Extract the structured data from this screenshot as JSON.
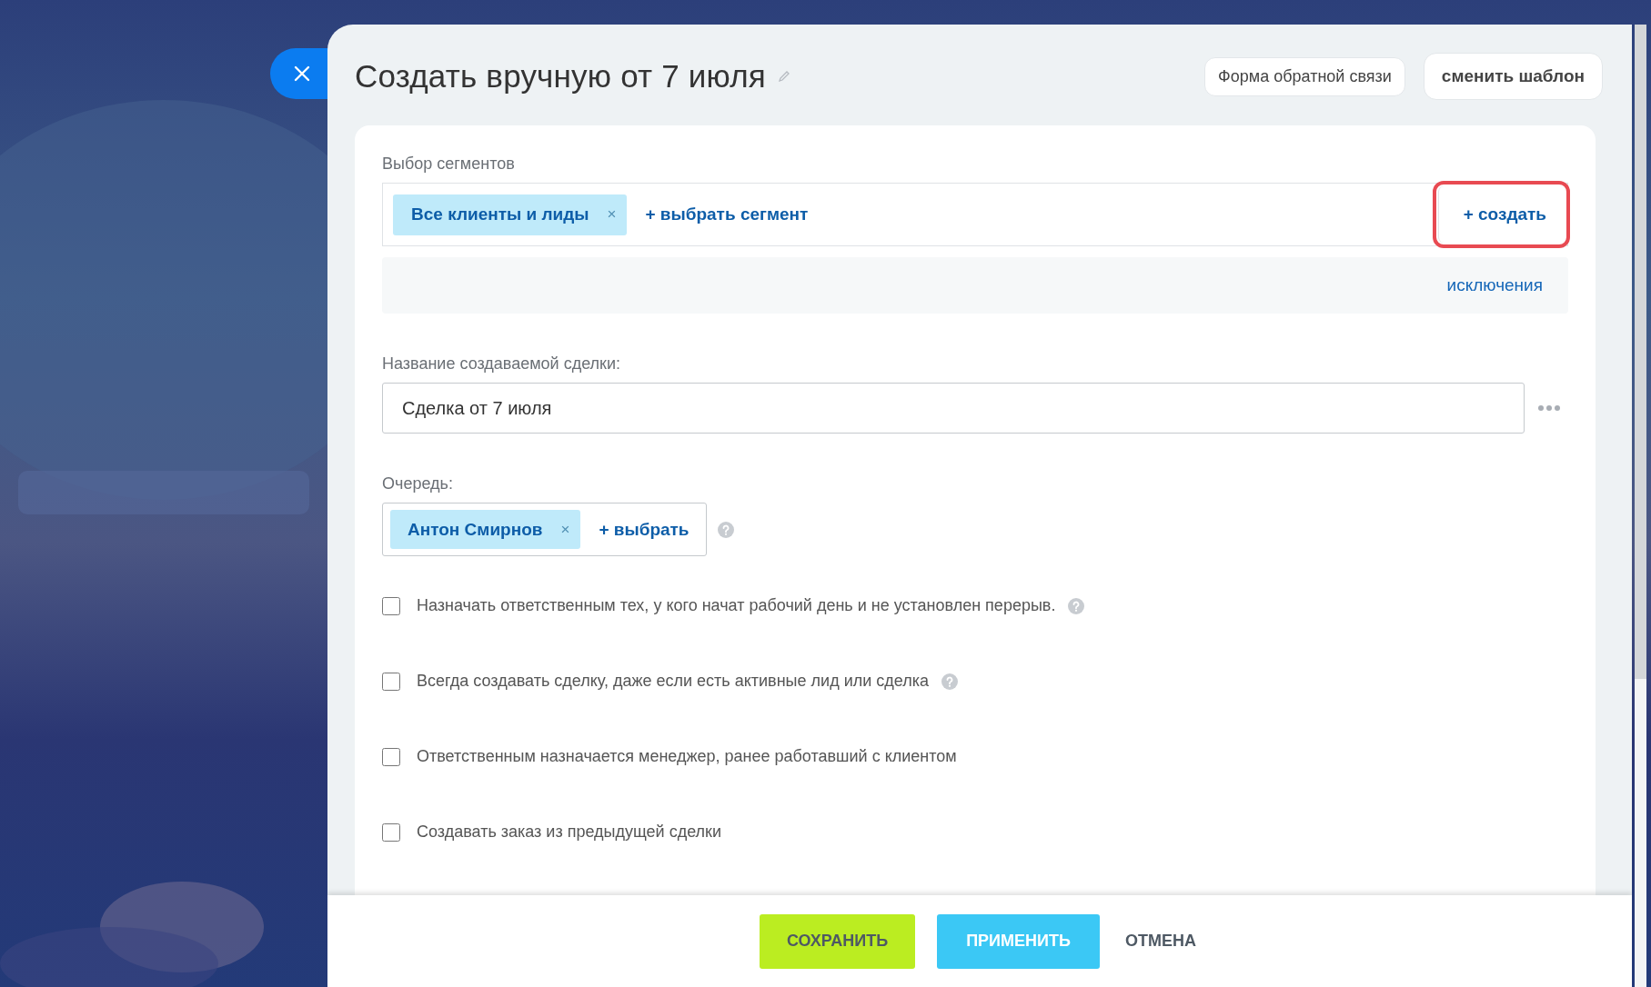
{
  "header": {
    "title": "Создать вручную от 7 июля",
    "buttons": [
      {
        "label": "Форма обратной связи",
        "kind": "plain"
      },
      {
        "label": "сменить шаблон",
        "kind": "bold"
      }
    ]
  },
  "segments": {
    "label": "Выбор сегментов",
    "tags": [
      {
        "label": "Все клиенты и лиды",
        "remove": "×"
      }
    ],
    "add_link": "+ выбрать сегмент",
    "create_button": "+ создать",
    "create_highlighted": true,
    "exclusions_link": "исключения"
  },
  "deal_name": {
    "label": "Название создаваемой сделки:",
    "value": "Сделка от 7 июля"
  },
  "queue": {
    "label": "Очередь:",
    "tags": [
      {
        "label": "Антон Смирнов",
        "remove": "×"
      }
    ],
    "add_link": "+ выбрать",
    "help": true
  },
  "options": [
    {
      "label": "Назначать ответственным тех, у кого начат рабочий день и не установлен перерыв.",
      "checked": false,
      "help": true
    },
    {
      "label": "Всегда создавать сделку, даже если есть активные лид или сделка",
      "checked": false,
      "help": true
    },
    {
      "label": "Ответственным назначается менеджер, ранее работавший с клиентом",
      "checked": false,
      "help": false
    },
    {
      "label": "Создавать заказ из предыдущей сделки",
      "checked": false,
      "help": false
    }
  ],
  "footer": {
    "buttons": [
      {
        "label": "СОХРАНИТЬ",
        "kind": "save"
      },
      {
        "label": "ПРИМЕНИТЬ",
        "kind": "apply"
      },
      {
        "label": "ОТМЕНА",
        "kind": "cancel"
      }
    ]
  }
}
